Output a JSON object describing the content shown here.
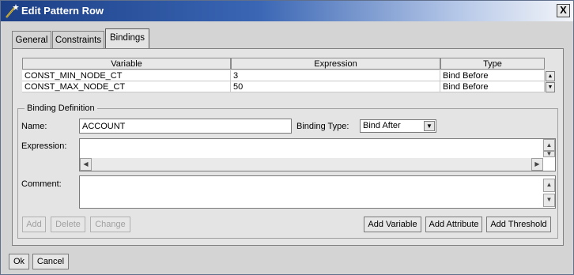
{
  "window": {
    "title": "Edit Pattern Row",
    "close_label": "X"
  },
  "tabs": [
    {
      "label": "General"
    },
    {
      "label": "Constraints"
    },
    {
      "label": "Bindings"
    }
  ],
  "bindings_table": {
    "columns": [
      "Variable",
      "Expression",
      "Type"
    ],
    "rows": [
      {
        "variable": "CONST_MIN_NODE_CT",
        "expression": "3",
        "type": "Bind Before"
      },
      {
        "variable": "CONST_MAX_NODE_CT",
        "expression": "50",
        "type": "Bind Before"
      }
    ]
  },
  "binding_definition": {
    "group_label": "Binding Definition",
    "name_label": "Name:",
    "name_value": "ACCOUNT",
    "binding_type_label": "Binding Type:",
    "binding_type_value": "Bind After",
    "expression_label": "Expression:",
    "comment_label": "Comment:"
  },
  "actions": {
    "add": "Add",
    "delete": "Delete",
    "change": "Change",
    "add_variable": "Add Variable",
    "add_attribute": "Add Attribute",
    "add_threshold": "Add Threshold"
  },
  "footer": {
    "ok": "Ok",
    "cancel": "Cancel"
  },
  "colors": {
    "title_bar": "#1c3f86",
    "dialog_bg": "#d4d4d4",
    "panel_bg": "#e4e4e4"
  }
}
